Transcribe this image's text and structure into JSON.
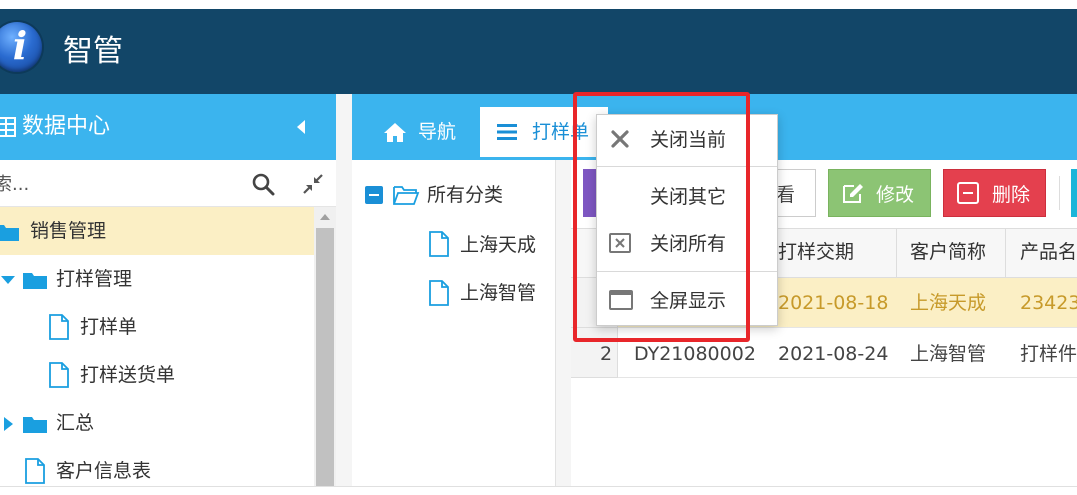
{
  "app": {
    "title": "智管"
  },
  "sidebar": {
    "title": "数据中心",
    "search_placeholder": "索...",
    "tree": [
      {
        "label": "销售管理",
        "selected": true
      },
      {
        "label": "打样管理"
      },
      {
        "label": "打样单"
      },
      {
        "label": "打样送货单"
      },
      {
        "label": "汇总"
      },
      {
        "label": "客户信息表"
      }
    ]
  },
  "tabs": {
    "nav_label": "导航",
    "active_label": "打样单"
  },
  "categories": {
    "root": "所有分类",
    "items": [
      "上海天成",
      "上海智管"
    ]
  },
  "toolbar": {
    "view_label": "看",
    "edit_label": "修改",
    "delete_label": "删除"
  },
  "grid": {
    "headers": {
      "date": "打样交期",
      "customer": "客户简称",
      "product": "产品名"
    },
    "rows": [
      {
        "index": "1",
        "code": "",
        "date": "2021-08-18",
        "customer": "上海天成",
        "product": "23423"
      },
      {
        "index": "2",
        "code": "DY21080002",
        "date": "2021-08-24",
        "customer": "上海智管",
        "product": "打样件"
      }
    ]
  },
  "context_menu": {
    "items": [
      "关闭当前",
      "关闭其它",
      "关闭所有",
      "全屏显示"
    ]
  },
  "colors": {
    "header_bg": "#124668",
    "accent": "#3bb4ee",
    "selected_row": "#fbefc5",
    "edit_button": "#8cc474",
    "delete_button": "#e4404e",
    "annotation": "#e8262a"
  }
}
